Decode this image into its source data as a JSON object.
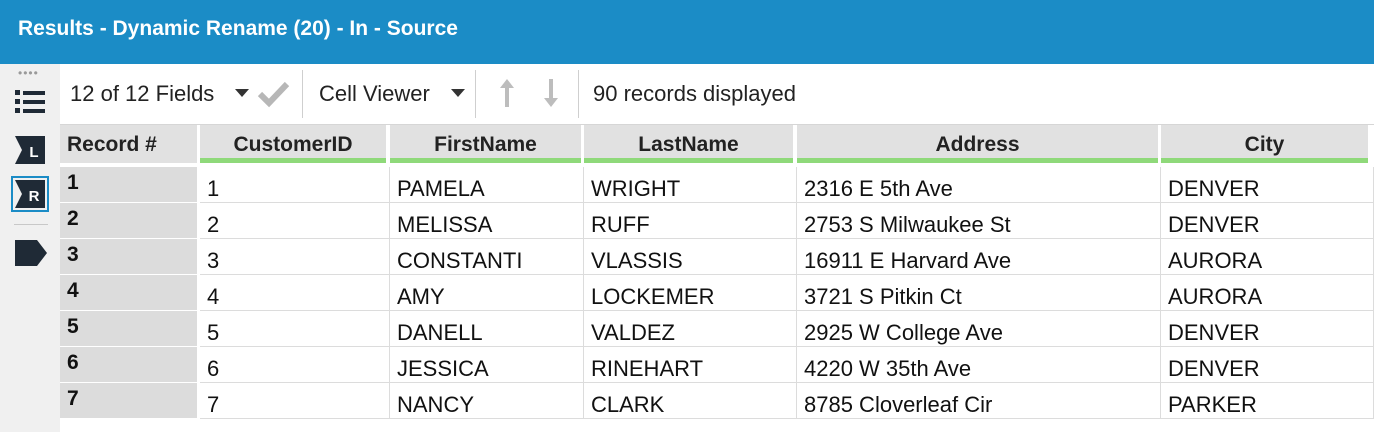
{
  "window": {
    "title": "Results - Dynamic Rename (20) - In - Source"
  },
  "toolbar": {
    "fields_label": "12 of 12 Fields",
    "cell_viewer_label": "Cell Viewer",
    "records_status": "90 records displayed"
  },
  "rail": {
    "left_label": "L",
    "right_label": "R"
  },
  "table": {
    "record_header": "Record #",
    "columns": [
      "CustomerID",
      "FirstName",
      "LastName",
      "Address",
      "City"
    ],
    "rows": [
      {
        "record": "1",
        "cells": [
          "1",
          "PAMELA",
          "WRIGHT",
          "2316 E 5th Ave",
          "DENVER"
        ]
      },
      {
        "record": "2",
        "cells": [
          "2",
          "MELISSA",
          "RUFF",
          "2753 S Milwaukee St",
          "DENVER"
        ]
      },
      {
        "record": "3",
        "cells": [
          "3",
          "CONSTANTI",
          "VLASSIS",
          "16911 E Harvard Ave",
          "AURORA"
        ]
      },
      {
        "record": "4",
        "cells": [
          "4",
          "AMY",
          "LOCKEMER",
          "3721 S Pitkin Ct",
          "AURORA"
        ]
      },
      {
        "record": "5",
        "cells": [
          "5",
          "DANELL",
          "VALDEZ",
          "2925 W College Ave",
          "DENVER"
        ]
      },
      {
        "record": "6",
        "cells": [
          "6",
          "JESSICA",
          "RINEHART",
          "4220 W 35th Ave",
          "DENVER"
        ]
      },
      {
        "record": "7",
        "cells": [
          "7",
          "NANCY",
          "CLARK",
          "8785 Cloverleaf Cir",
          "PARKER"
        ]
      }
    ]
  },
  "colors": {
    "titlebar": "#1b8cc6",
    "field_underline": "#8fd97a",
    "icon": "#1f2a36"
  }
}
